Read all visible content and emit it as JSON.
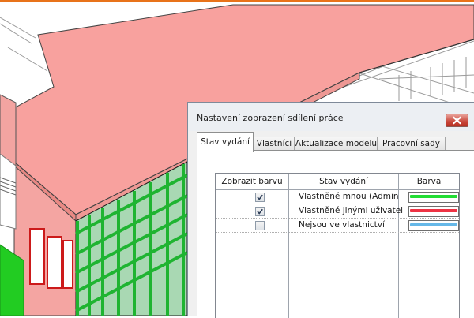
{
  "dialog": {
    "title": "Nastavení zobrazení sdílení práce",
    "close_icon": "close-icon"
  },
  "tabs": [
    {
      "label": "Stav vydání",
      "active": true
    },
    {
      "label": "Vlastníci",
      "active": false
    },
    {
      "label": "Aktualizace modelu",
      "active": false
    },
    {
      "label": "Pracovní sady",
      "active": false
    }
  ],
  "table": {
    "headers": {
      "show_color": "Zobrazit barvu",
      "status": "Stav vydání",
      "color": "Barva"
    },
    "rows": [
      {
        "checked": true,
        "status": "Vlastněné mnou (Admin",
        "color": "#22dd33"
      },
      {
        "checked": true,
        "status": "Vlastněné jinými uživatel",
        "color": "#ee3344"
      },
      {
        "checked": false,
        "status": "Nejsou ve vlastnictví",
        "color": "#66b8e8"
      }
    ]
  },
  "colors": {
    "roof": "#f8a19e",
    "wall": "#f4a5a2",
    "frame_green": "#1fb431",
    "accent_orange": "#e8731a"
  }
}
